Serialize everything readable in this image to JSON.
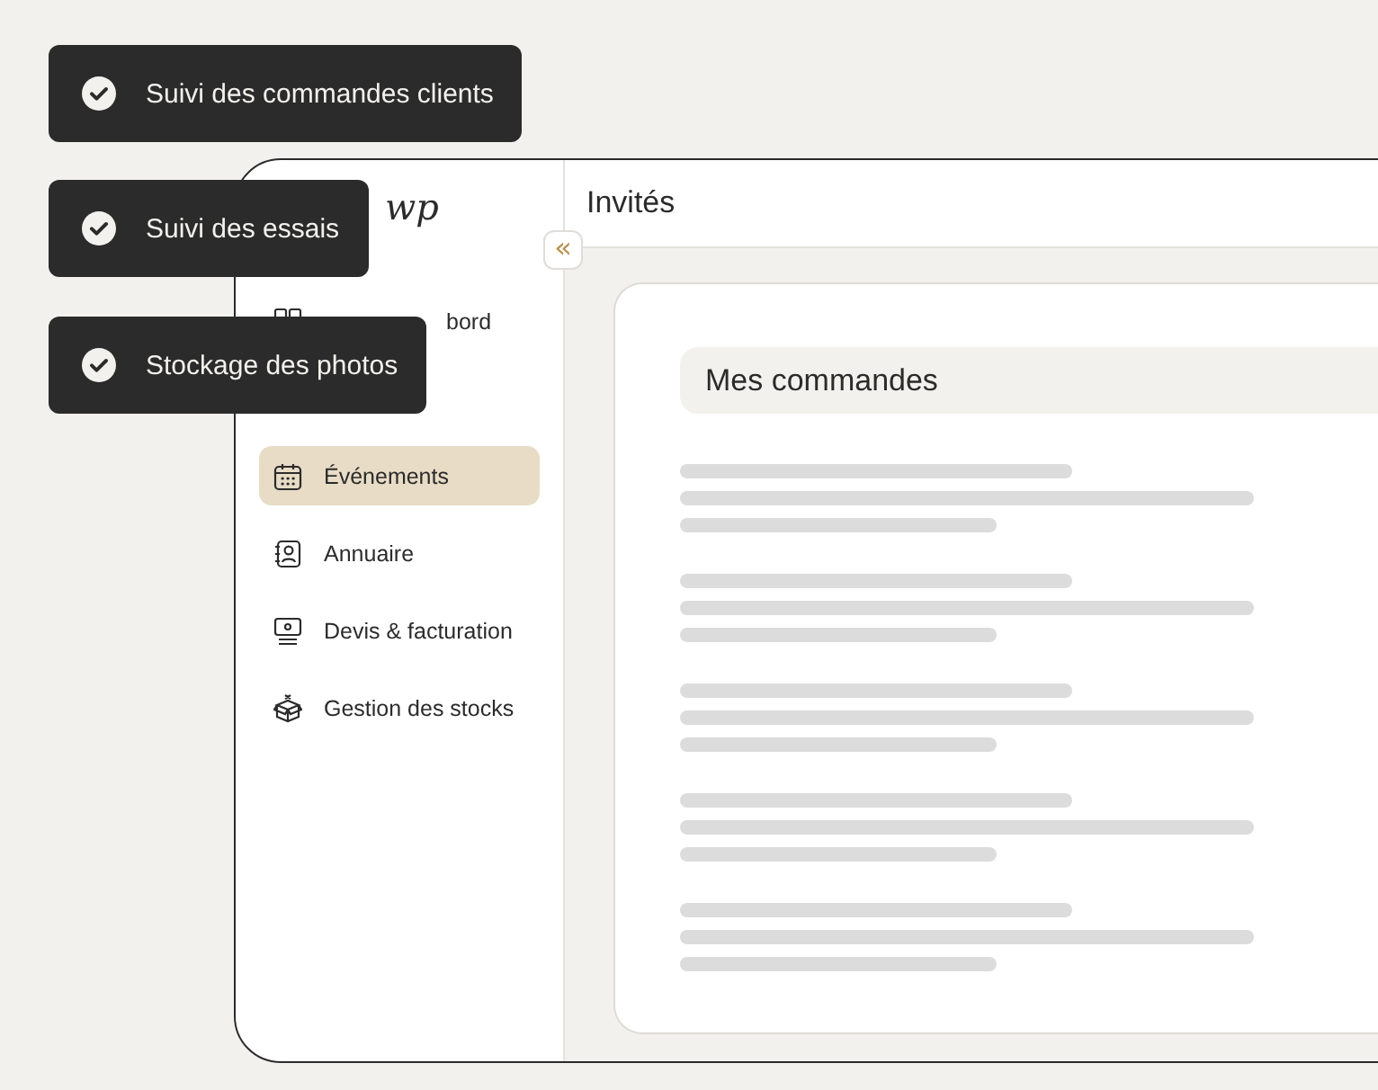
{
  "feature_badges": [
    {
      "label": "Suivi des commandes clients",
      "checked": true
    },
    {
      "label": "Suivi des essais",
      "checked": true
    },
    {
      "label": "Stockage des photos",
      "checked": true
    }
  ],
  "sidebar": {
    "logo": "wp",
    "collapse_button": "«",
    "items": [
      {
        "label": "bord",
        "selected": false
      },
      {
        "label": "Événements",
        "selected": true
      },
      {
        "label": "Annuaire",
        "selected": false
      },
      {
        "label": "Devis & facturation",
        "selected": false
      },
      {
        "label": "Gestion des stocks",
        "selected": false
      }
    ]
  },
  "header": {
    "title": "Invités"
  },
  "card": {
    "title": "Mes commandes",
    "rows": [
      {
        "kind": "skeleton"
      },
      {
        "kind": "skeleton"
      },
      {
        "kind": "skeleton"
      },
      {
        "kind": "skeleton"
      },
      {
        "kind": "skeleton"
      }
    ]
  }
}
